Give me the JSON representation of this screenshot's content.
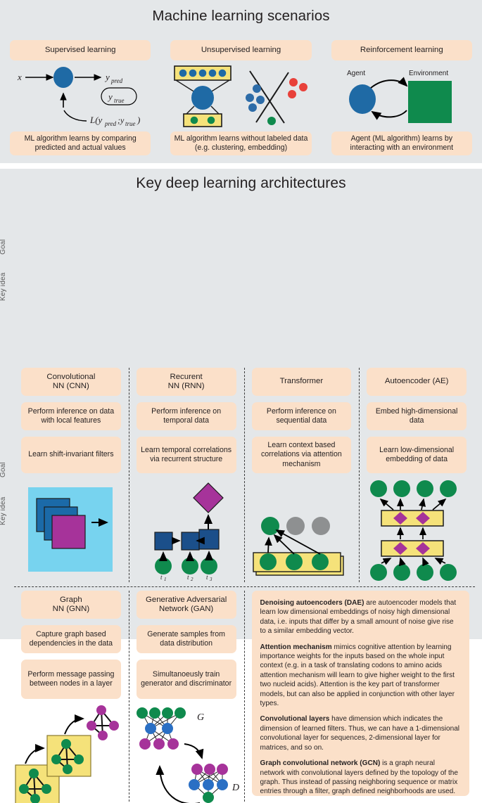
{
  "colors": {
    "panel_bg": "#e4e7e9",
    "card_peach": "#fbe0c9",
    "blue_node": "#1f6aa5",
    "blue_square": "#1b4f8a",
    "green_node": "#0f8a4d",
    "green_env": "#0f8a4d",
    "yellow_box": "#f5e27a",
    "magenta": "#a63596",
    "purple_diamond": "#a6339a",
    "cyan_plane": "#77d3ef",
    "red_dot": "#e8413a",
    "grey_node": "#8e9091",
    "text": "#231f20"
  },
  "ml_panel": {
    "title": "Machine learning scenarios",
    "columns": [
      {
        "header": "Supervised learning",
        "footer": "ML algorithm learns by comparing predicted and actual values",
        "figure_labels": {
          "input": "x",
          "output": "y_pred",
          "target": "y_true",
          "loss": "L(y_pred;y_true)"
        }
      },
      {
        "header": "Unsupervised learning",
        "footer": "ML algorithm learns without labeled data (e.g. clustering, embedding)",
        "figure_labels": {}
      },
      {
        "header": "Reinforcement learning",
        "footer": "Agent (ML algorithm) learns by interacting with an environment",
        "figure_labels": {
          "agent": "Agent",
          "environment": "Environment"
        }
      }
    ]
  },
  "dl_panel": {
    "title": "Key deep learning architectures",
    "row_labels": {
      "goal": "Goal",
      "idea": "Key idea"
    },
    "row1": [
      {
        "name": "Convolutional\nNN (CNN)",
        "name_line1": "Convolutional",
        "name_line2": "NN (CNN)",
        "goal": "Perform inference on data with local features",
        "idea": "Learn shift-invariant filters"
      },
      {
        "name_line1": "Recurent",
        "name_line2": "NN (RNN)",
        "goal": "Perform inference on temporal data",
        "idea": "Learn temporal correlations via recurrent structure",
        "figure_labels": {
          "t1": "t",
          "t2": "t",
          "t3": "t",
          "s1": "1",
          "s2": "2",
          "s3": "3"
        }
      },
      {
        "name_line1": "Transformer",
        "name_line2": "",
        "goal": "Perform inference on sequential data",
        "idea": "Learn context based correlations via attention mechanism"
      },
      {
        "name_line1": "Autoencoder (AE)",
        "name_line2": "",
        "goal": "Embed high-dimensional data",
        "idea": "Learn low-dimensional embedding of data"
      }
    ],
    "row2": [
      {
        "name_line1": "Graph",
        "name_line2": "NN (GNN)",
        "goal": "Capture graph based dependencies in the data",
        "idea": "Perform message passing between nodes in a layer"
      },
      {
        "name_line1": "Generative Adversarial",
        "name_line2": "Network (GAN)",
        "goal": "Generate samples from data distribution",
        "idea": "Simultanoeusly train generator and discriminator",
        "figure_labels": {
          "generator": "G",
          "discriminator": "D"
        }
      }
    ],
    "glossary": [
      {
        "term": "Denoising autoencoders (DAE)",
        "body": " are autoencoder models that learn low dimensional embeddings of noisy high dimensional data, i.e. inputs that differ by a small amount of noise give rise to a similar embedding vector."
      },
      {
        "term": "Attention mechanism",
        "body": " mimics cognitive attention by learning importance weights for the inputs based on the whole input context (e.g. in a task of translating codons to amino acids attention mechanism will learn to give higher weight to the first two nucleid acids). Attention is the key part of transformer models, but can also be applied in conjunction with other layer types."
      },
      {
        "term": "Convolutional layers",
        "body": " have dimension which indicates the dimension of learned filters. Thus, we can have a 1-dimensional convolutional layer for sequences, 2-dimensional layer for matrices, and so on."
      },
      {
        "term": "Graph convolutional network (GCN)",
        "body": " is a graph neural network with convolutional layers defined by the topology of the graph. Thus instead of passing neighboring sequence or matrix entries through a filter, graph defined neighborhoods are used."
      }
    ]
  }
}
